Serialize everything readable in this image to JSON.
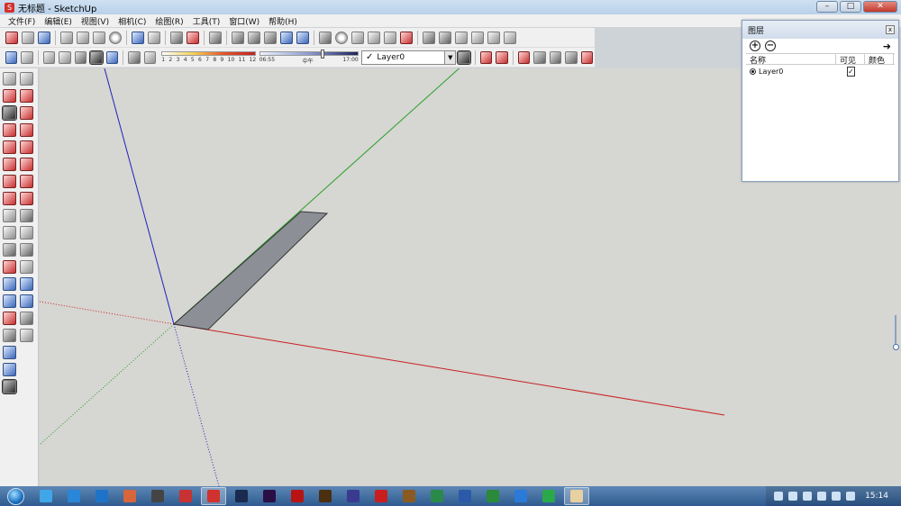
{
  "window": {
    "title": "无标题 - SketchUp",
    "controls": {
      "minimize": "–",
      "maximize": "□",
      "close": "✕"
    }
  },
  "menu": [
    "文件(F)",
    "编辑(E)",
    "视图(V)",
    "相机(C)",
    "绘图(R)",
    "工具(T)",
    "窗口(W)",
    "帮助(H)"
  ],
  "toolbar": {
    "shadow_scale_numbers": [
      "1",
      "2",
      "3",
      "4",
      "5",
      "6",
      "7",
      "8",
      "9",
      "10",
      "11",
      "12"
    ],
    "time_labels": {
      "start": "06:55",
      "mid": "中午",
      "end": "17:00"
    },
    "time_position": 0.64,
    "current_layer": "Layer0",
    "current_layer_check": "✓",
    "dropdown_arrow": "▼"
  },
  "layers_panel": {
    "title": "图层",
    "close_glyph": "x",
    "add_glyph": "+",
    "remove_glyph": "−",
    "details_glyph": "➜",
    "columns": {
      "name": "名称",
      "visible": "可见",
      "color": "颜色"
    },
    "rows": [
      {
        "name": "Layer0",
        "visible_mark": "✓",
        "color": "#ee5050"
      }
    ]
  },
  "viewport": {
    "axis_colors": {
      "red": "#c82020",
      "green": "#28a028",
      "blue": "#2020b8"
    },
    "shape_fill": "#8c9096",
    "background": "#d6d6d2"
  },
  "taskbar": {
    "apps": [
      {
        "icon": "cloud-app-icon",
        "color": "#3fa7e8"
      },
      {
        "icon": "k-app-icon",
        "color": "#2a86d8"
      },
      {
        "icon": "browser-icon",
        "color": "#1e73c9"
      },
      {
        "icon": "paint-icon",
        "color": "#d9653a"
      },
      {
        "icon": "camera-icon",
        "color": "#444444"
      },
      {
        "icon": "acrobat-icon",
        "color": "#c83232"
      },
      {
        "icon": "sketchup-icon",
        "color": "#d2322d",
        "active": true
      },
      {
        "icon": "photoshop-icon",
        "color": "#1b2a4f"
      },
      {
        "icon": "premiere-icon",
        "color": "#2a0f45"
      },
      {
        "icon": "record-icon",
        "color": "#b81414"
      },
      {
        "icon": "bridge-icon",
        "color": "#4a2f10"
      },
      {
        "icon": "folder-icon",
        "color": "#3a3a90"
      },
      {
        "icon": "pdf-icon",
        "color": "#c81e1e"
      },
      {
        "icon": "film-icon",
        "color": "#8a5a20"
      },
      {
        "icon": "paint-canvas-icon",
        "color": "#2a8a4a"
      },
      {
        "icon": "word-icon",
        "color": "#2a5aa8"
      },
      {
        "icon": "excel-icon",
        "color": "#2a8a3a"
      },
      {
        "icon": "wps-writer-icon",
        "color": "#2a7ad8"
      },
      {
        "icon": "wps-sheet-icon",
        "color": "#2aa84a"
      },
      {
        "icon": "sketchup-window-icon",
        "color": "#e8d0a0",
        "active": true
      }
    ],
    "clock": "15:14"
  }
}
